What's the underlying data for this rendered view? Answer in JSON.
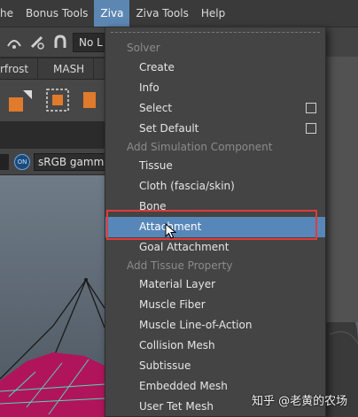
{
  "menubar": {
    "items": [
      "he",
      "Bonus Tools",
      "Ziva",
      "Ziva Tools",
      "Help"
    ],
    "active_index": 2
  },
  "toolbar": {
    "partial_text": "No L"
  },
  "shelf_tabs": [
    "rfrost",
    "MASH"
  ],
  "viewport_bar": {
    "on_label": "ON",
    "colorspace": "sRGB gamma"
  },
  "ziva_menu": {
    "section_solver": "Solver",
    "create": "Create",
    "info": "Info",
    "select": "Select",
    "set_default": "Set Default",
    "section_add_component": "Add Simulation Component",
    "tissue": "Tissue",
    "cloth": "Cloth (fascia/skin)",
    "bone": "Bone",
    "attachment": "Attachment",
    "goal_attachment": "Goal Attachment",
    "section_add_tissue_property": "Add Tissue Property",
    "material_layer": "Material Layer",
    "muscle_fiber": "Muscle Fiber",
    "muscle_line_of_action": "Muscle Line-of-Action",
    "collision_mesh": "Collision Mesh",
    "subtissue": "Subtissue",
    "embedded_mesh": "Embedded Mesh",
    "user_tet_mesh": "User Tet Mesh"
  },
  "watermark": "知乎 @老黄的农场",
  "colors": {
    "highlight": "#5787b8",
    "annotation_box": "#e03b3b",
    "menu_bg": "#444444"
  }
}
